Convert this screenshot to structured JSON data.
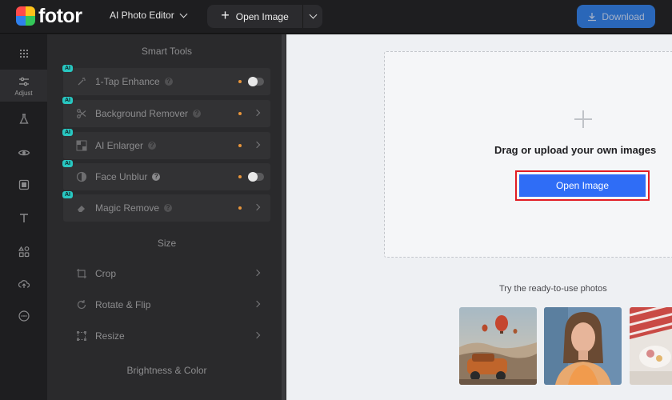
{
  "app": {
    "logo_text": "fotor",
    "editor_mode": "AI Photo Editor"
  },
  "toolbar": {
    "open_image_label": "Open Image",
    "download_label": "Download"
  },
  "rail": {
    "adjust_label": "Adjust"
  },
  "panel": {
    "smart_tools_title": "Smart Tools",
    "smart_tools": [
      {
        "label": "1-Tap Enhance",
        "ai": "AI",
        "control": "toggle"
      },
      {
        "label": "Background Remover",
        "ai": "AI",
        "control": "arrow"
      },
      {
        "label": "AI Enlarger",
        "ai": "AI",
        "control": "arrow"
      },
      {
        "label": "Face Unblur",
        "ai": "AI",
        "control": "toggle"
      },
      {
        "label": "Magic Remove",
        "ai": "AI",
        "control": "arrow"
      }
    ],
    "size_title": "Size",
    "size_tools": [
      {
        "label": "Crop"
      },
      {
        "label": "Rotate & Flip"
      },
      {
        "label": "Resize"
      }
    ],
    "brightness_title": "Brightness & Color"
  },
  "canvas": {
    "drag_text": "Drag or upload your own images",
    "open_image_label": "Open Image",
    "try_text": "Try the ready-to-use photos"
  },
  "colors": {
    "accent": "#2f6df6",
    "badge": "#28c7c1",
    "highlight_border": "#e11d24",
    "dot": "#e8953b"
  }
}
